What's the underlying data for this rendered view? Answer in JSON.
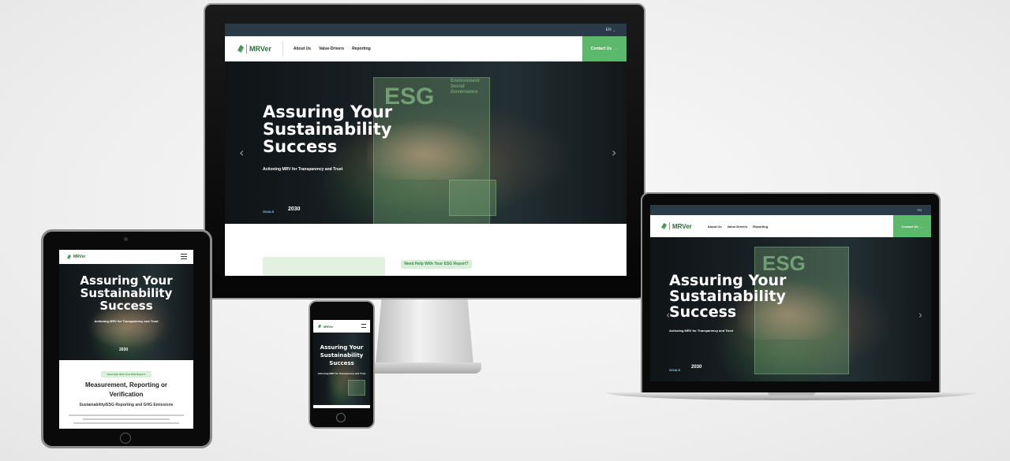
{
  "site": {
    "lang": "EN",
    "logo_text": "MRVer",
    "nav": [
      "About Us",
      "Value-Drivers",
      "Reporting"
    ],
    "contact_label": "Contact Us",
    "hero_title_1": "Assuring Your",
    "hero_title_2": "Sustainability",
    "hero_title_3": "Success",
    "hero_subtitle": "Actioning MRV for Transparency and Trust",
    "esg_label": "ESG",
    "esg_words": [
      "Environment",
      "Social",
      "Governance"
    ],
    "help_label": "Need Help With Your ESG Report?",
    "section_heading_1": "Measurement, Reporting or",
    "section_heading_2": "Verification",
    "section_sub": "Sustainability/ESG Reporting and GHG Emissions",
    "badges": [
      "GOALS",
      "2030"
    ]
  },
  "icons": {
    "prev": "chevron-left-icon",
    "next": "chevron-right-icon",
    "menu": "hamburger-menu-icon",
    "arrow": "arrow-right-icon"
  },
  "colors": {
    "brand_green": "#5cb86a",
    "topbar": "#2a3a46",
    "accent_text": "#3d8a47"
  }
}
